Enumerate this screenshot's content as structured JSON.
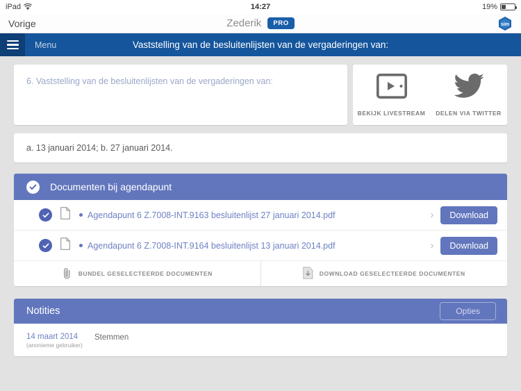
{
  "status_bar": {
    "device": "iPad",
    "wifi_icon": "wifi-icon",
    "time": "14:27",
    "battery_percent": "19%",
    "battery_icon": "battery-icon"
  },
  "nav_bar": {
    "back_label": "Vorige",
    "title": "Zederik",
    "pro_badge": "PRO",
    "account_icon": "sim-logo-icon"
  },
  "blue_bar": {
    "menu_icon": "hamburger-menu-icon",
    "menu_label": "Menu",
    "title": "Vaststelling van de besluitenlijsten van de vergaderingen van:"
  },
  "agenda": {
    "text": "6. Vaststelling van de besluitenlijsten van de vergaderingen van:"
  },
  "media": {
    "items": [
      {
        "icon": "livestream-monitor-icon",
        "label": "BEKIJK LIVESTREAM"
      },
      {
        "icon": "twitter-bird-icon",
        "label": "DELEN VIA TWITTER"
      }
    ]
  },
  "dates": {
    "text": "a. 13 januari 2014;  b. 27 januari 2014."
  },
  "documents": {
    "header_icon": "checkmark-circle-icon",
    "header_title": "Documenten bij agendapunt",
    "rows": [
      {
        "checked": true,
        "file_icon": "page-icon",
        "name": "Agendapunt 6 Z.7008-INT.9163  besluitenlijst 27 januari 2014.pdf",
        "chevron": "chevron-right-icon",
        "download_label": "Download"
      },
      {
        "checked": true,
        "file_icon": "page-icon",
        "name": "Agendapunt 6 Z.7008-INT.9164  besluitenlijst 13 januari 2014.pdf",
        "chevron": "chevron-right-icon",
        "download_label": "Download"
      }
    ],
    "actions": [
      {
        "icon": "paperclip-icon",
        "label": "BUNDEL GESELECTEERDE DOCUMENTEN"
      },
      {
        "icon": "document-download-icon",
        "label": "DOWNLOAD GESELECTEERDE DOCUMENTEN"
      }
    ]
  },
  "notes": {
    "title": "Notities",
    "options_label": "Opties",
    "entries": [
      {
        "date": "14 maart 2014",
        "author": "(anonieme gebruiker)",
        "body": "Stemmen"
      }
    ]
  },
  "colors": {
    "nav_blue": "#14559c",
    "nav_blue_dark": "#0e3f76",
    "accent_periwinkle": "#6276bd",
    "pro_badge_blue": "#1b5ea8",
    "page_background": "#e2e2e2"
  }
}
